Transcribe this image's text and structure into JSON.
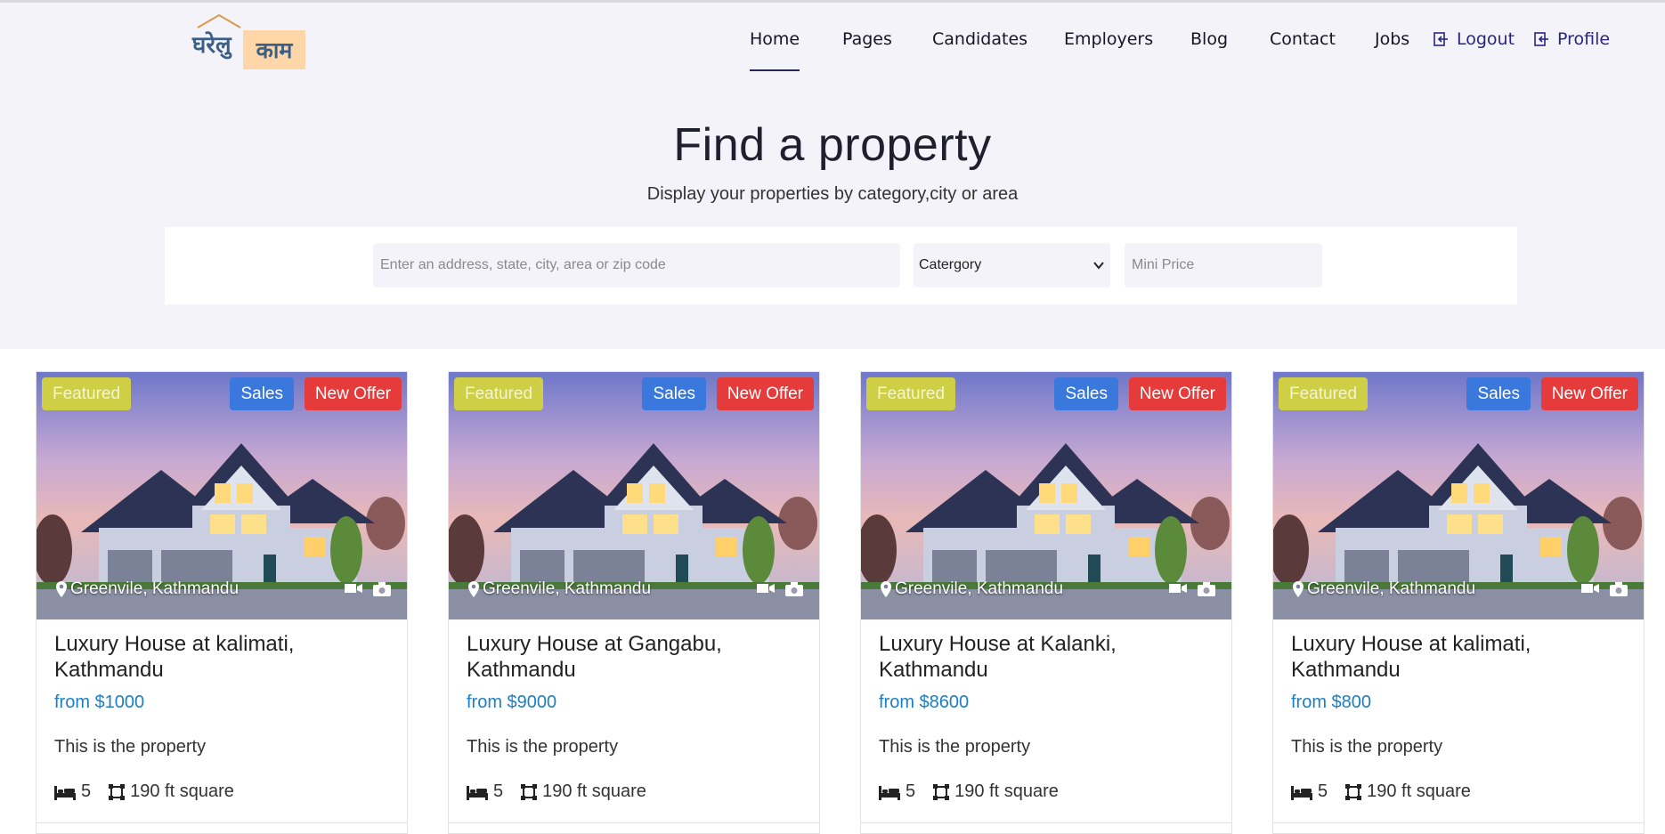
{
  "logo": {
    "word1": "घरेलु",
    "word2": "काम"
  },
  "nav": {
    "items": [
      "Home",
      "Pages",
      "Candidates",
      "Employers",
      "Blog",
      "Contact",
      "Jobs"
    ],
    "active": "Home",
    "logout": "Logout",
    "profile": "Profile"
  },
  "hero": {
    "title": "Find a property",
    "subtitle": "Display your properties by category,city or area"
  },
  "search": {
    "address_placeholder": "Enter an address, state, city, area or zip code",
    "category_value": "Catergory",
    "price_placeholder": "Mini Price"
  },
  "badges": {
    "featured": "Featured",
    "sales": "Sales",
    "offer": "New Offer"
  },
  "cards": [
    {
      "location": "Greenvile, Kathmandu",
      "title": "Luxury House at kalimati, Kathmandu",
      "price": "from $1000",
      "desc": "This is the property",
      "beds": "5",
      "area": "190 ft square"
    },
    {
      "location": "Greenvile, Kathmandu",
      "title": "Luxury House at Gangabu, Kathmandu",
      "price": "from $9000",
      "desc": "This is the property",
      "beds": "5",
      "area": "190 ft square"
    },
    {
      "location": "Greenvile, Kathmandu",
      "title": "Luxury House at Kalanki, Kathmandu",
      "price": "from $8600",
      "desc": "This is the property",
      "beds": "5",
      "area": "190 ft square"
    },
    {
      "location": "Greenvile, Kathmandu",
      "title": "Luxury House at kalimati, Kathmandu",
      "price": "from $800",
      "desc": "This is the property",
      "beds": "5",
      "area": "190 ft square"
    }
  ],
  "colors": {
    "hero_bg": "#f3f3f9",
    "nav_text": "#161626",
    "nav_accent": "#2a2580",
    "featured_badge": "#cfcf45",
    "sales_badge": "#3a78dd",
    "offer_badge": "#e63b3b",
    "price_text": "#1c7fc4"
  },
  "icons": [
    "house-roof-icon",
    "logout-icon",
    "map-pin-icon",
    "video-icon",
    "camera-icon",
    "bed-icon",
    "area-icon",
    "chevron-down-icon"
  ]
}
